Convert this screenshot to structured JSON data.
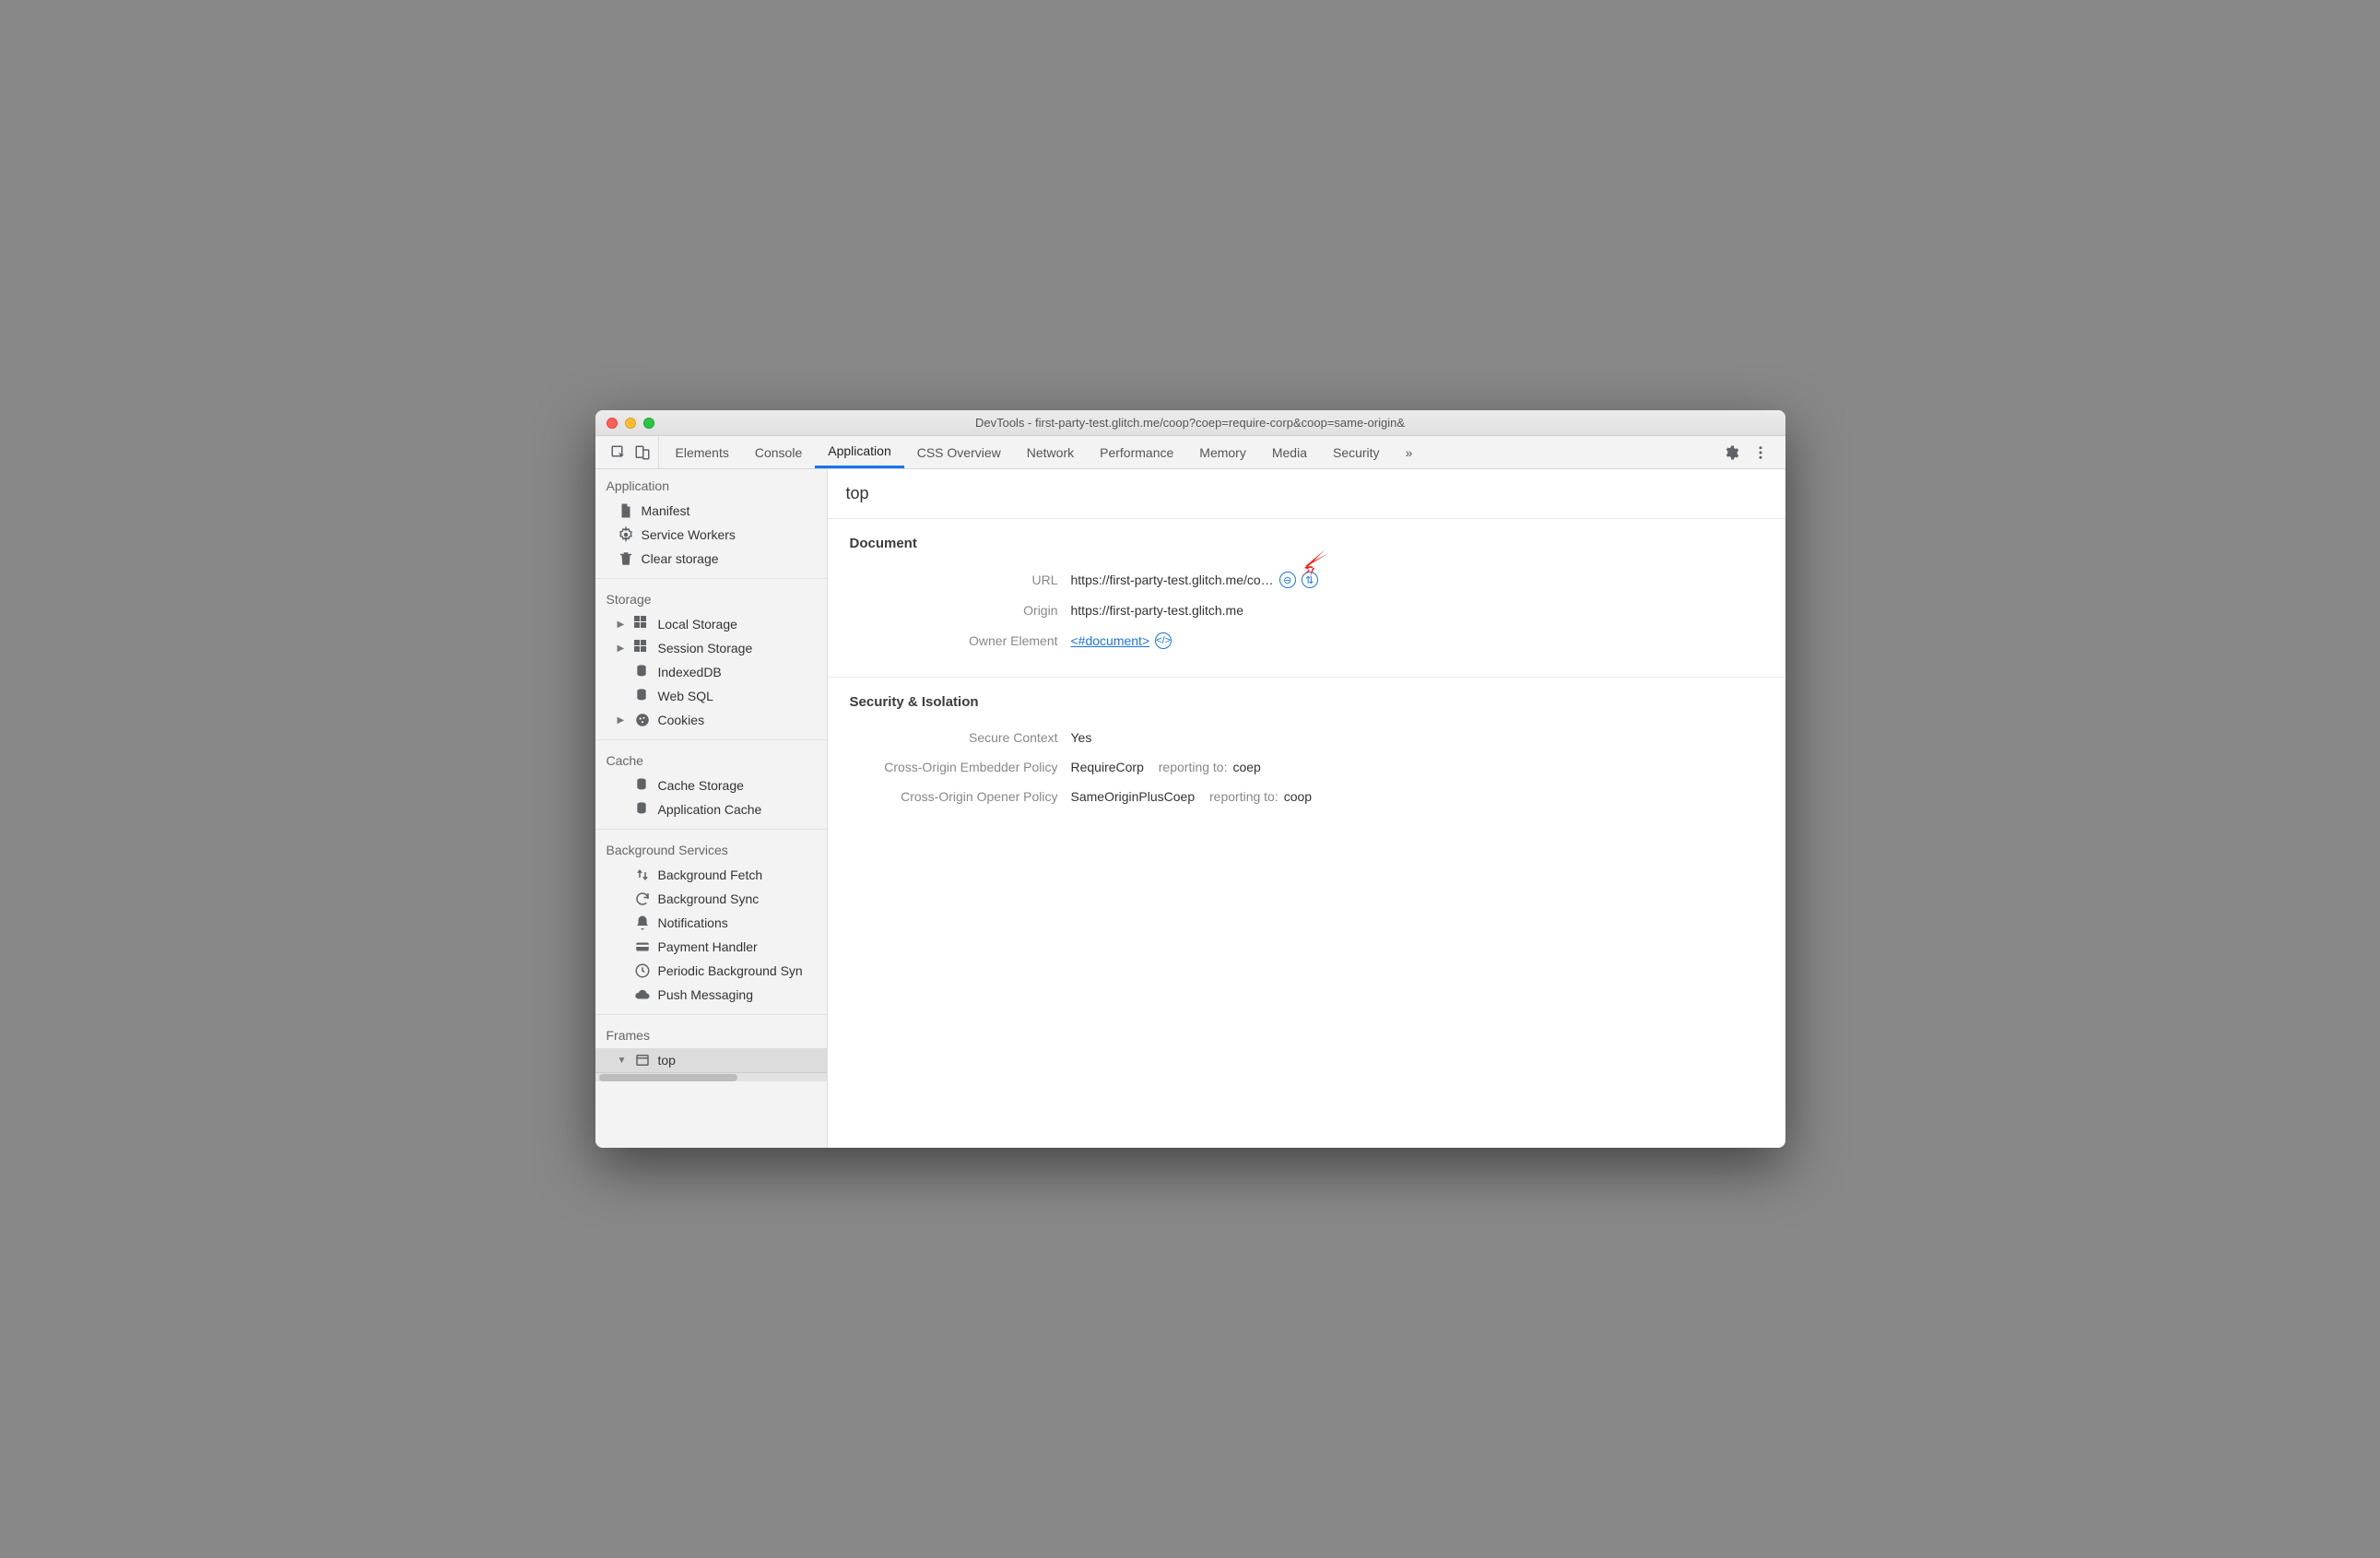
{
  "window": {
    "title": "DevTools - first-party-test.glitch.me/coop?coep=require-corp&coop=same-origin&"
  },
  "tabs": {
    "items": [
      "Elements",
      "Console",
      "Application",
      "CSS Overview",
      "Network",
      "Performance",
      "Memory",
      "Media",
      "Security"
    ],
    "active_index": 2,
    "overflow_glyph": "»"
  },
  "sidebar": {
    "groups": [
      {
        "title": "Application",
        "items": [
          {
            "icon": "file",
            "label": "Manifest"
          },
          {
            "icon": "gear",
            "label": "Service Workers"
          },
          {
            "icon": "trash",
            "label": "Clear storage"
          }
        ]
      },
      {
        "title": "Storage",
        "items": [
          {
            "icon": "grid",
            "label": "Local Storage",
            "caret": true
          },
          {
            "icon": "grid",
            "label": "Session Storage",
            "caret": true
          },
          {
            "icon": "db",
            "label": "IndexedDB"
          },
          {
            "icon": "db",
            "label": "Web SQL"
          },
          {
            "icon": "cookie",
            "label": "Cookies",
            "caret": true
          }
        ]
      },
      {
        "title": "Cache",
        "items": [
          {
            "icon": "db",
            "label": "Cache Storage"
          },
          {
            "icon": "db",
            "label": "Application Cache"
          }
        ]
      },
      {
        "title": "Background Services",
        "items": [
          {
            "icon": "updown",
            "label": "Background Fetch"
          },
          {
            "icon": "sync",
            "label": "Background Sync"
          },
          {
            "icon": "bell",
            "label": "Notifications"
          },
          {
            "icon": "card",
            "label": "Payment Handler"
          },
          {
            "icon": "clock",
            "label": "Periodic Background Syn"
          },
          {
            "icon": "cloud",
            "label": "Push Messaging"
          }
        ]
      },
      {
        "title": "Frames",
        "items": [
          {
            "icon": "frame",
            "label": "top",
            "caret_open": true,
            "selected": true
          }
        ]
      }
    ]
  },
  "content": {
    "frame_title": "top",
    "sections": {
      "document": {
        "heading": "Document",
        "url_label": "URL",
        "url_value": "https://first-party-test.glitch.me/co…",
        "origin_label": "Origin",
        "origin_value": "https://first-party-test.glitch.me",
        "owner_label": "Owner Element",
        "owner_link": "<#document>"
      },
      "security": {
        "heading": "Security & Isolation",
        "secure_context_label": "Secure Context",
        "secure_context_value": "Yes",
        "coep_label": "Cross-Origin Embedder Policy",
        "coep_value": "RequireCorp",
        "coep_reporting_prefix": "reporting to:",
        "coep_reporting_value": "coep",
        "coop_label": "Cross-Origin Opener Policy",
        "coop_value": "SameOriginPlusCoep",
        "coop_reporting_prefix": "reporting to:",
        "coop_reporting_value": "coop"
      }
    }
  }
}
